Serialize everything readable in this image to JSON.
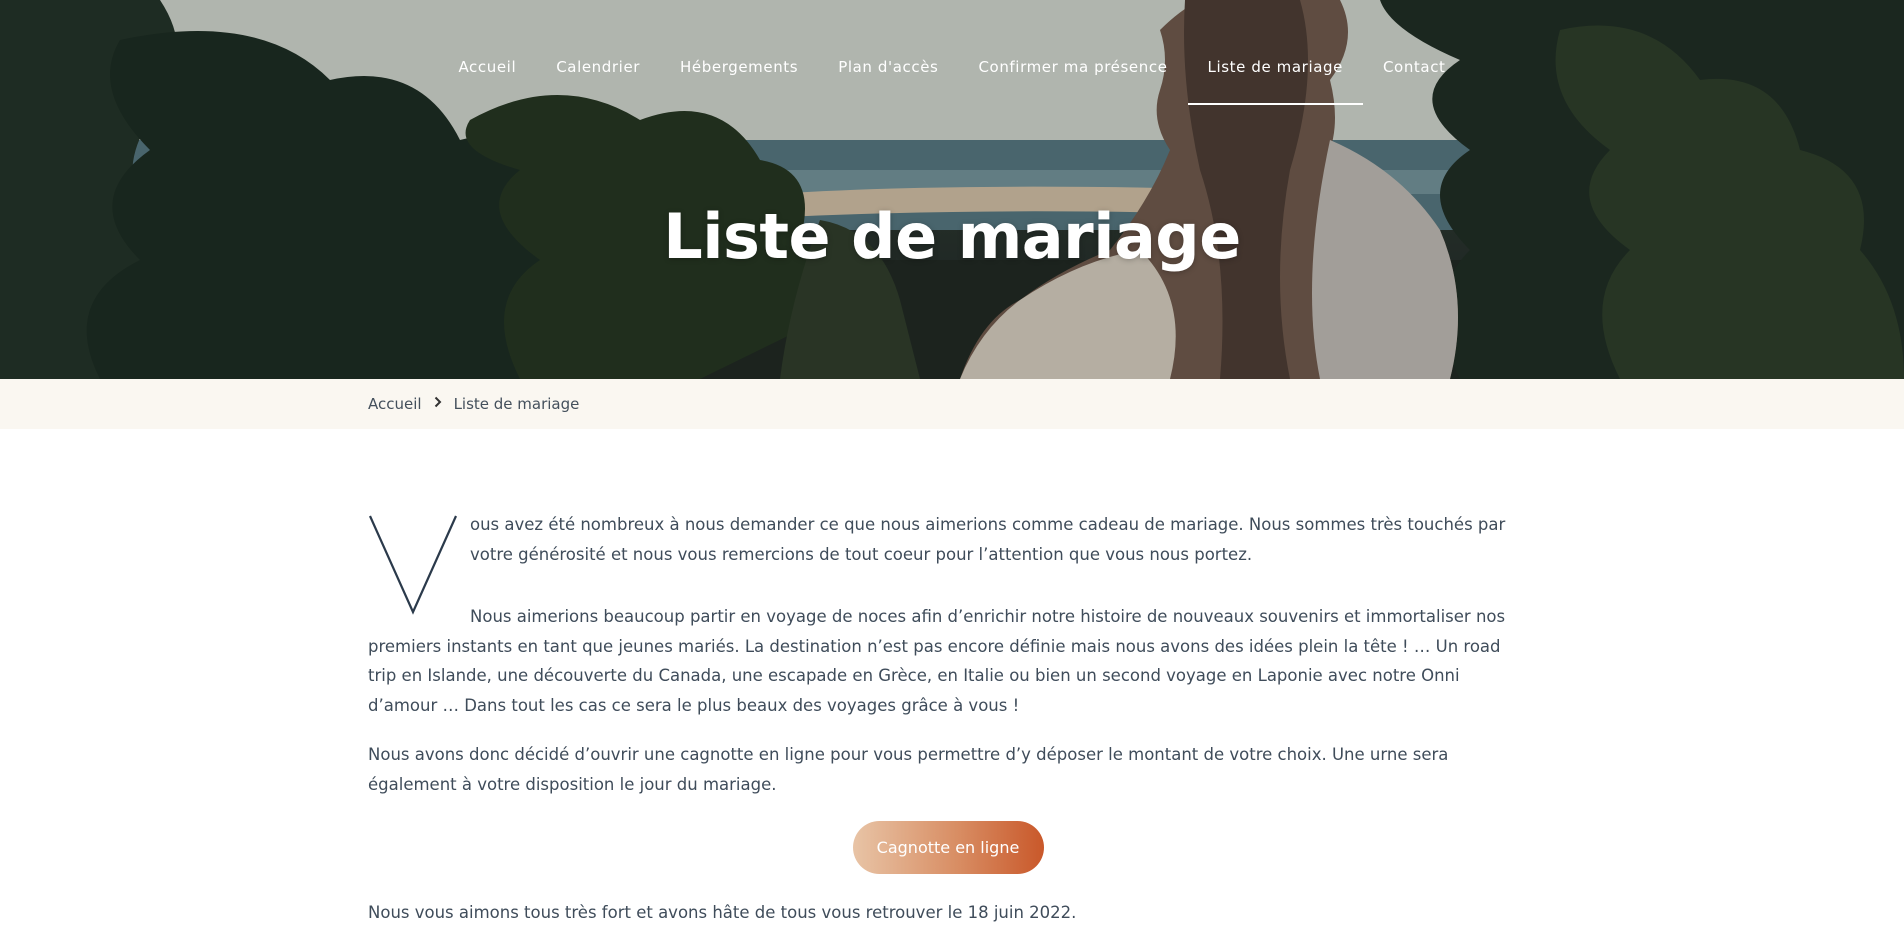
{
  "nav": {
    "items": [
      {
        "label": "Accueil"
      },
      {
        "label": "Calendrier"
      },
      {
        "label": "Hébergements"
      },
      {
        "label": "Plan d'accès"
      },
      {
        "label": "Confirmer ma présence"
      },
      {
        "label": "Liste de mariage",
        "active": true
      },
      {
        "label": "Contact"
      }
    ]
  },
  "hero": {
    "title": "Liste de mariage"
  },
  "breadcrumb": {
    "home": "Accueil",
    "current": "Liste de mariage",
    "separator_icon": "chevron-right-icon"
  },
  "content": {
    "dropcap": "V",
    "intro": "ous avez été nombreux à nous demander ce que nous aimerions comme cadeau de mariage. Nous sommes très touchés par votre générosité et nous vous remercions de tout coeur pour l’attention que vous nous portez.",
    "para2": "Nous aimerions beaucoup partir en voyage de noces afin d’enrichir notre histoire de nouveaux souvenirs et immortaliser nos premiers instants en tant que jeunes mariés. La destination n’est pas encore définie mais nous avons des idées plein la tête ! … Un road trip en Islande, une découverte du Canada, une escapade en Grèce, en Italie ou bien un second voyage en Laponie avec notre Onni d’amour … Dans tout les cas ce sera le plus beaux des voyages grâce à vous !",
    "para3": "Nous avons donc décidé d’ouvrir une cagnotte en ligne pour vous permettre d’y déposer le montant de votre choix. Une urne sera également à votre disposition le jour du mariage.",
    "button_label": "Cagnotte en ligne",
    "para4": "Nous vous aimons tous très fort et avons hâte de tous vous retrouver le 18 juin 2022."
  },
  "colors": {
    "accent_gradient_start": "#e8c4a6",
    "accent_gradient_end": "#c9582a",
    "breadcrumb_bg": "#faf7f1",
    "dropcap": "#2b3a4b"
  }
}
